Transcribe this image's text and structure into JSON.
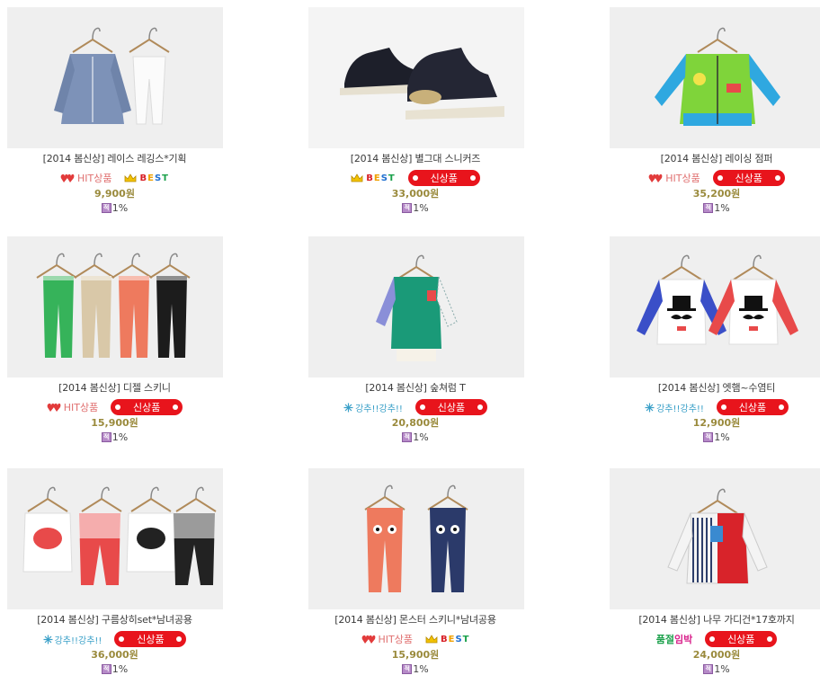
{
  "products": [
    {
      "name": "[2014 봄신상] 레이스 레깅스*기획",
      "badges": [
        "hit",
        "best"
      ],
      "price": "9,900원",
      "point": "1%",
      "image": "shirt-leggings"
    },
    {
      "name": "[2014 봄신상] 별그대 스니커즈",
      "badges": [
        "best",
        "new"
      ],
      "price": "33,000원",
      "point": "1%",
      "image": "sneakers"
    },
    {
      "name": "[2014 봄신상] 레이싱 점퍼",
      "badges": [
        "hit",
        "new"
      ],
      "price": "35,200원",
      "point": "1%",
      "image": "jumper"
    },
    {
      "name": "[2014 봄신상] 디젤 스키니",
      "badges": [
        "hit",
        "new"
      ],
      "price": "15,900원",
      "point": "1%",
      "image": "skinny-pants"
    },
    {
      "name": "[2014 봄신상] 숲쳐럼 T",
      "badges": [
        "stock",
        "new"
      ],
      "price": "20,800원",
      "point": "1%",
      "image": "green-tee"
    },
    {
      "name": "[2014 봄신상] 엣햄~수염티",
      "badges": [
        "stock",
        "new"
      ],
      "price": "12,900원",
      "point": "1%",
      "image": "mustache-tee"
    },
    {
      "name": "[2014 봄신상] 구름상히set*남녀공용",
      "badges": [
        "stock",
        "new"
      ],
      "price": "36,000원",
      "point": "1%",
      "image": "cloud-set"
    },
    {
      "name": "[2014 봄신상] 몬스터 스키니*남녀공용",
      "badges": [
        "hit",
        "best"
      ],
      "price": "15,900원",
      "point": "1%",
      "image": "monster-skinny"
    },
    {
      "name": "[2014 봄신상] 나무 가디건*17호까지",
      "badges": [
        "sold",
        "new"
      ],
      "price": "24,000원",
      "point": "1%",
      "image": "cardigan"
    }
  ],
  "badge_text": {
    "hit": "HIT상품",
    "best": "BEST",
    "new": "신상품",
    "stock": "강추!!강추!!",
    "sold_1": "품절",
    "sold_2": "임박"
  },
  "point_icon": "적",
  "colors": {
    "new_badge": "#e8141c",
    "price": "#9a8a3c",
    "hit": "#e07070"
  }
}
